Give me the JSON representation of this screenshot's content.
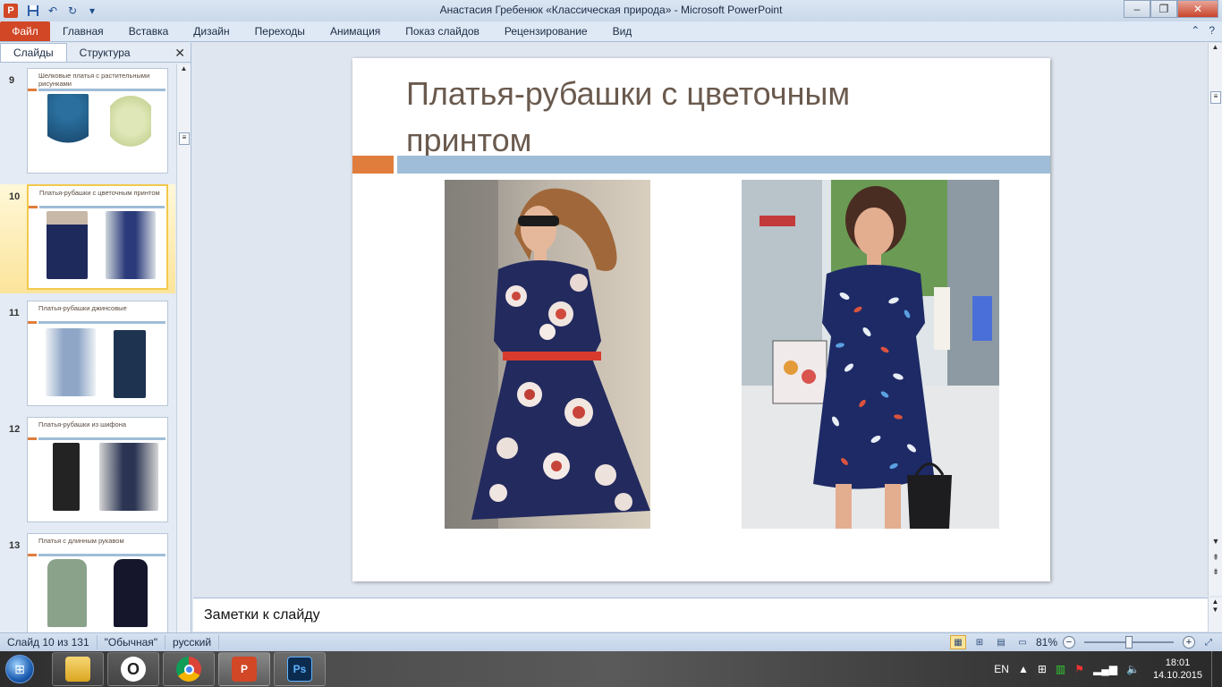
{
  "window": {
    "title": "Анастасия Гребенюк «Классическая природа» - Microsoft PowerPoint",
    "app_icon": "P",
    "controls": {
      "minimize": "–",
      "maximize": "❐",
      "close": "✕"
    }
  },
  "quick_access": {
    "save": "💾",
    "undo": "↶",
    "redo": "↻",
    "customize": "▾"
  },
  "ribbon": {
    "file_tab": "Файл",
    "tabs": [
      "Главная",
      "Вставка",
      "Дизайн",
      "Переходы",
      "Анимация",
      "Показ слайдов",
      "Рецензирование",
      "Вид"
    ],
    "help": "?",
    "collapse": "⌃"
  },
  "left_panel": {
    "tabs": [
      "Слайды",
      "Структура"
    ],
    "active_tab": "Слайды",
    "close": "✕",
    "thumbnails": [
      {
        "number": "9",
        "title": "Шелковые платья с растительными рисунками",
        "selected": false
      },
      {
        "number": "10",
        "title": "Платья-рубашки с цветочным принтом",
        "selected": true
      },
      {
        "number": "11",
        "title": "Платья-рубашки джинсовые",
        "selected": false
      },
      {
        "number": "12",
        "title": "Платья-рубашки из шифона",
        "selected": false
      },
      {
        "number": "13",
        "title": "Платья с длинным рукавом",
        "selected": false
      }
    ]
  },
  "slide": {
    "title": "Платья-рубашки с цветочным принтом",
    "accent_orange": "#e07d3c",
    "accent_blue": "#9fbdd8"
  },
  "notes": {
    "placeholder": "Заметки к слайду"
  },
  "status": {
    "slide_info": "Слайд 10 из 131",
    "theme": "\"Обычная\"",
    "language": "русский",
    "zoom": "81%"
  },
  "taskbar": {
    "language": "EN",
    "time": "18:01",
    "date": "14.10.2015",
    "apps": [
      "explorer",
      "opera",
      "chrome",
      "powerpoint",
      "photoshop"
    ],
    "photoshop_label": "Ps",
    "opera_label": "O"
  }
}
